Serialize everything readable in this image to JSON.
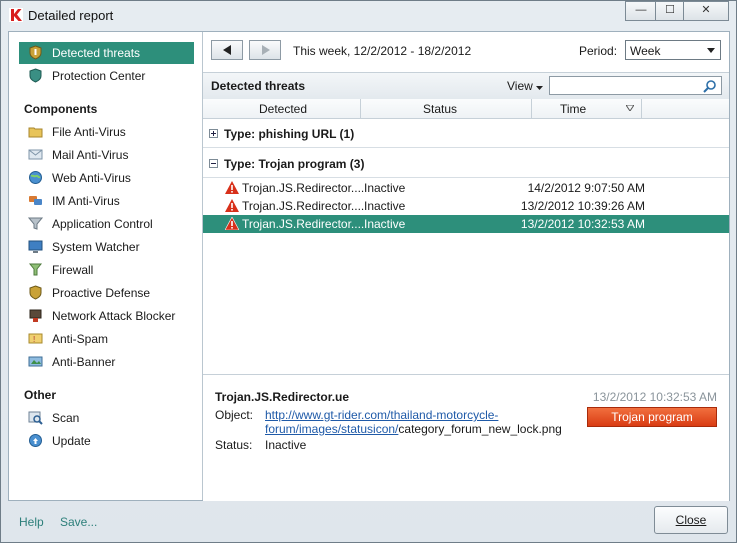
{
  "window": {
    "title": "Detailed report",
    "controls": {
      "minimize": "—",
      "maximize": "☐",
      "close": "✕"
    }
  },
  "sidebar": {
    "top_items": [
      {
        "label": "Detected threats",
        "icon": "shield-icon",
        "selected": true
      },
      {
        "label": "Protection Center",
        "icon": "shield-icon",
        "selected": false
      }
    ],
    "components_heading": "Components",
    "components": [
      {
        "label": "File Anti-Virus",
        "icon": "folder-icon"
      },
      {
        "label": "Mail Anti-Virus",
        "icon": "mail-icon"
      },
      {
        "label": "Web Anti-Virus",
        "icon": "globe-icon"
      },
      {
        "label": "IM Anti-Virus",
        "icon": "chat-icon"
      },
      {
        "label": "Application Control",
        "icon": "funnel-icon"
      },
      {
        "label": "System Watcher",
        "icon": "monitor-icon"
      },
      {
        "label": "Firewall",
        "icon": "firewall-icon"
      },
      {
        "label": "Proactive Defense",
        "icon": "shield-icon"
      },
      {
        "label": "Network Attack Blocker",
        "icon": "network-icon"
      },
      {
        "label": "Anti-Spam",
        "icon": "spam-icon"
      },
      {
        "label": "Anti-Banner",
        "icon": "banner-icon"
      }
    ],
    "other_heading": "Other",
    "other": [
      {
        "label": "Scan",
        "icon": "scan-icon"
      },
      {
        "label": "Update",
        "icon": "update-icon"
      }
    ]
  },
  "nav": {
    "range": "This week, 12/2/2012 - 18/2/2012",
    "period_label": "Period:",
    "period_value": "Week"
  },
  "toolbar": {
    "title": "Detected threats",
    "view_label": "View",
    "search_placeholder": ""
  },
  "columns": {
    "detected": "Detected",
    "status": "Status",
    "time": "Time"
  },
  "groups": [
    {
      "label": "Type: phishing URL (1)",
      "expanded": false
    },
    {
      "label": "Type: Trojan program (3)",
      "expanded": true
    }
  ],
  "rows": [
    {
      "name": "Trojan.JS.Redirector....",
      "status": "Inactive",
      "time": "14/2/2012 9:07:50 AM",
      "selected": false
    },
    {
      "name": "Trojan.JS.Redirector....",
      "status": "Inactive",
      "time": "13/2/2012 10:39:26 AM",
      "selected": false
    },
    {
      "name": "Trojan.JS.Redirector....",
      "status": "Inactive",
      "time": "13/2/2012 10:32:53 AM",
      "selected": true
    }
  ],
  "detail": {
    "name": "Trojan.JS.Redirector.ue",
    "time": "13/2/2012 10:32:53 AM",
    "object_label": "Object:",
    "object_link_1": "http://www.gt-rider.com/thailand-motorcycle-",
    "object_link_2": "forum/images/statusicon/",
    "object_rest": "category_forum_new_lock.png",
    "status_label": "Status:",
    "status_value": "Inactive",
    "type_button": "Trojan program"
  },
  "footer": {
    "help": "Help",
    "save": "Save...",
    "close": "Close"
  },
  "colors": {
    "accent": "#2d8f7b",
    "danger": "#e0481c",
    "link": "#1f5aa8"
  }
}
